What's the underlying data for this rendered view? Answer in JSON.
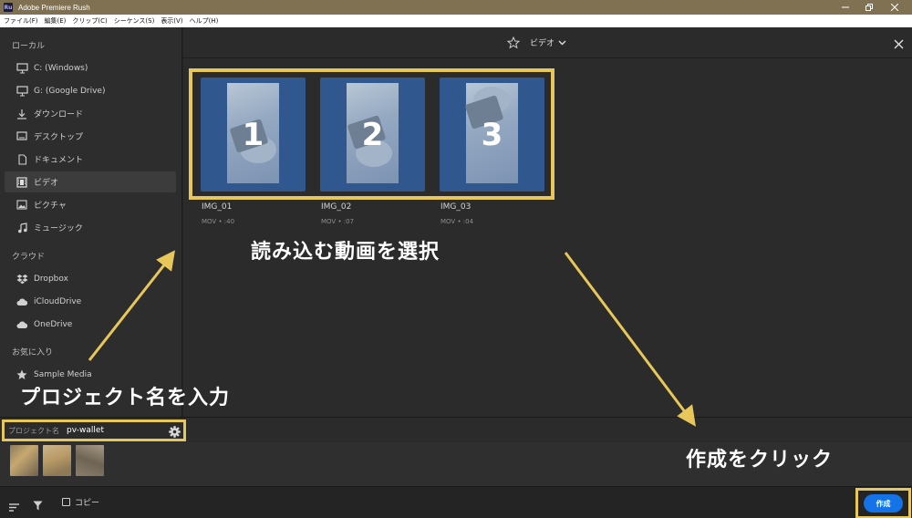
{
  "window": {
    "title": "Adobe Premiere Rush",
    "app_icon": "Ru"
  },
  "menu": [
    "ファイル(F)",
    "編集(E)",
    "クリップ(C)",
    "シーケンス(S)",
    "表示(V)",
    "ヘルプ(H)"
  ],
  "sidebar": {
    "local_title": "ローカル",
    "local_items": [
      {
        "label": "C: (Windows)",
        "icon": "monitor-icon"
      },
      {
        "label": "G: (Google Drive)",
        "icon": "monitor-icon"
      },
      {
        "label": "ダウンロード",
        "icon": "download-icon"
      },
      {
        "label": "デスクトップ",
        "icon": "desktop-icon"
      },
      {
        "label": "ドキュメント",
        "icon": "document-icon"
      },
      {
        "label": "ビデオ",
        "icon": "film-icon",
        "active": true
      },
      {
        "label": "ピクチャ",
        "icon": "picture-icon"
      },
      {
        "label": "ミュージック",
        "icon": "music-icon"
      }
    ],
    "cloud_title": "クラウド",
    "cloud_items": [
      {
        "label": "Dropbox",
        "icon": "dropbox-icon"
      },
      {
        "label": "iCloudDrive",
        "icon": "cloud-icon"
      },
      {
        "label": "OneDrive",
        "icon": "cloud-icon"
      }
    ],
    "favorites_title": "お気に入り",
    "favorite_items": [
      {
        "label": "Sample Media",
        "icon": "star-filled-icon"
      }
    ]
  },
  "main": {
    "folder_label": "ビデオ",
    "clips": [
      {
        "number": "1",
        "name": "IMG_01",
        "meta": "MOV • :40"
      },
      {
        "number": "2",
        "name": "IMG_02",
        "meta": "MOV • :07"
      },
      {
        "number": "3",
        "name": "IMG_03",
        "meta": "MOV • :04"
      }
    ]
  },
  "project": {
    "label": "プロジェクト名",
    "name": "pv-wallet"
  },
  "footer": {
    "copy_label": "コピー",
    "create_label": "作成"
  },
  "annotations": {
    "select_videos": "読み込む動画を選択",
    "enter_project_name": "プロジェクト名を入力",
    "click_create": "作成をクリック"
  },
  "colors": {
    "highlight": "#e8c75a",
    "thumbnail_bg": "#30588f",
    "create_button": "#1473e6",
    "titlebar": "#807152"
  }
}
